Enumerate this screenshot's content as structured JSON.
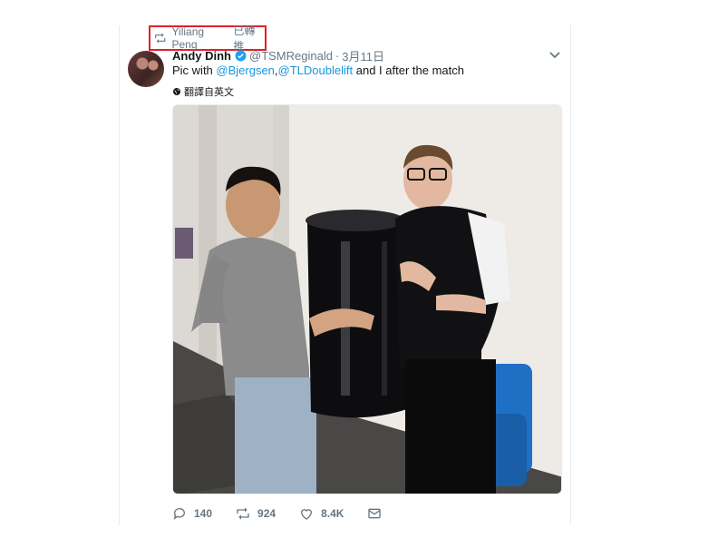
{
  "retweet": {
    "by": "Yiliang Peng",
    "suffix": "已轉推",
    "icon": "retweet-icon"
  },
  "tweet": {
    "author_name": "Andy Dinh",
    "handle": "@TSMReginald",
    "date": "3月11日",
    "text_prefix": "Pic with ",
    "mention_1": "@Bjergsen",
    "comma": ",",
    "mention_2": "@TLDoublelift",
    "text_suffix": " and I after the match",
    "translate_label": "翻譯自英文"
  },
  "actions": {
    "reply_count": "140",
    "retweet_count": "924",
    "like_count": "8.4K"
  },
  "colors": {
    "link": "#1b95e0",
    "secondary": "#657786",
    "highlight_box": "#e0202a"
  }
}
